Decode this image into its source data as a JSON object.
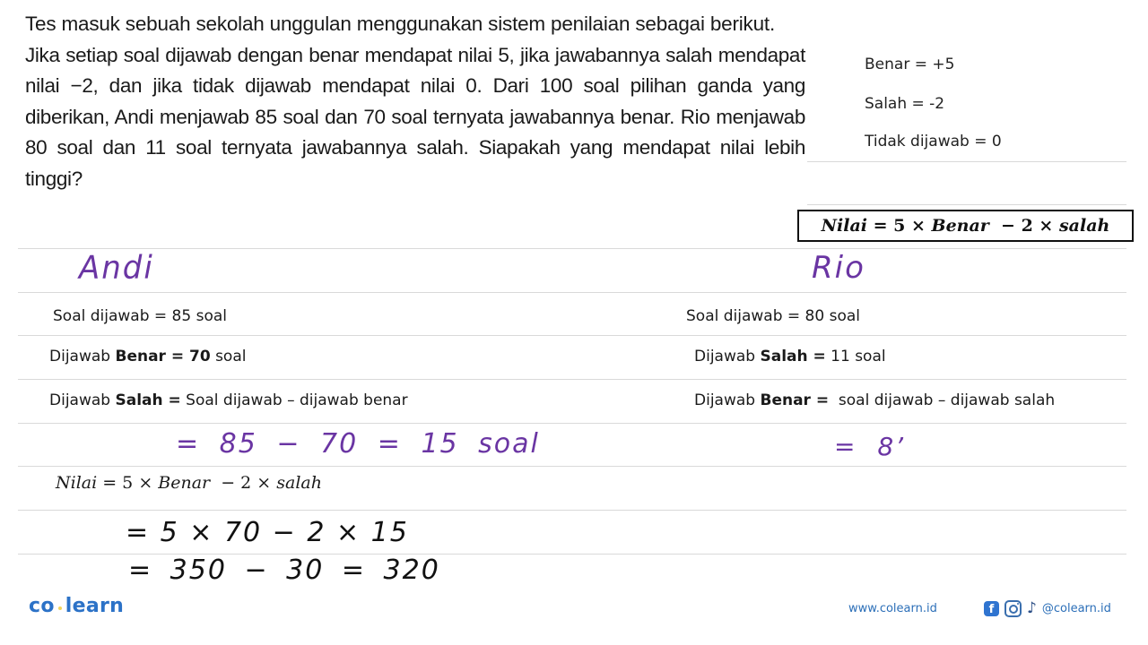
{
  "question": {
    "paragraph1": "Tes masuk sebuah sekolah unggulan menggunakan sistem penilaian sebagai berikut.",
    "paragraph2": "Jika setiap soal dijawab dengan benar mendapat nilai 5, jika jawabannya salah mendapat nilai −2, dan jika tidak dijawab mendapat nilai 0. Dari 100 soal pilihan ganda yang diberikan, Andi menjawab 85 soal dan 70 soal ternyata jawabannya benar. Rio menjawab 80 soal dan 11 soal ternyata jawabannya salah. Siapakah yang mendapat nilai lebih tinggi?"
  },
  "rules": [
    "Benar = +5",
    "Salah = -2",
    "Tidak dijawab = 0"
  ],
  "formula_box": {
    "lhs": "Nilai",
    "eq": " = 5 × ",
    "term1": "Benar",
    "op": "  − 2 × ",
    "term2": "salah"
  },
  "andi": {
    "name": "Andi",
    "row1": "Soal dijawab = 85 soal",
    "row2": {
      "prefix": "Dijawab ",
      "bold": "Benar = 70",
      "suffix": " soal"
    },
    "row3": {
      "prefix": "Dijawab ",
      "bold": "Salah =",
      "suffix": " Soal dijawab – dijawab benar"
    },
    "salah_calc": "= 85 − 70 = 15 soal",
    "formula": {
      "lhs": "Nilai",
      "eq": " = 5 × ",
      "term1": "Benar",
      "op": "  − 2 × ",
      "term2": "salah"
    },
    "step1": "= 5 × 70 − 2 × 15",
    "step2": "= 350 − 30  = 320"
  },
  "rio": {
    "name": "Rio",
    "row1": "Soal dijawab = 80 soal",
    "row2": {
      "prefix": "Dijawab ",
      "bold": "Salah =",
      "suffix": " 11 soal"
    },
    "row3": {
      "prefix": "Dijawab ",
      "bold": "Benar =",
      "suffix": "  soal dijawab – dijawab salah"
    },
    "benar_calc": "= 8’"
  },
  "footer": {
    "logo_left": "co",
    "logo_right": "learn",
    "website": "www.colearn.id",
    "social_icons": [
      "facebook-icon",
      "instagram-icon",
      "tiktok-icon"
    ],
    "handle": "@colearn.id"
  },
  "colors": {
    "handwriting_purple": "#6a35a3",
    "brand_blue": "#2c72c7",
    "brand_dot_yellow": "#f2d45c"
  }
}
